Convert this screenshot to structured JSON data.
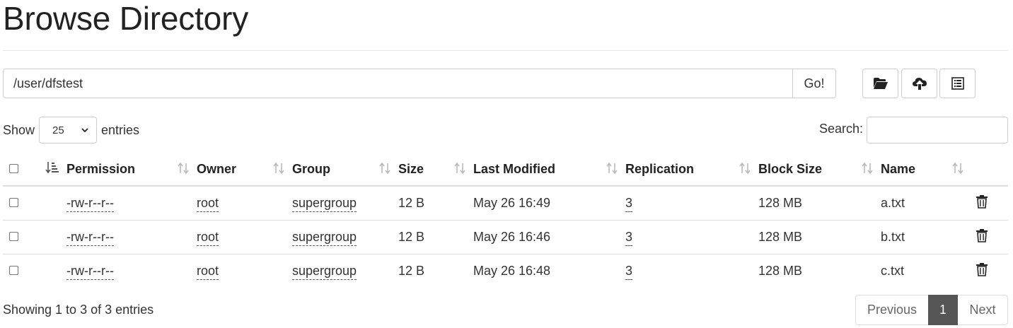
{
  "header": {
    "title": "Browse Directory"
  },
  "path_bar": {
    "value": "/user/dfstest",
    "go_label": "Go!"
  },
  "toolbar": {
    "buttons": [
      {
        "icon": "folder-open-icon"
      },
      {
        "icon": "cloud-upload-icon"
      },
      {
        "icon": "list-icon"
      }
    ]
  },
  "length_control": {
    "show_label": "Show",
    "selected": "25",
    "entries_label": "entries"
  },
  "search": {
    "label": "Search:",
    "value": ""
  },
  "table": {
    "columns": [
      "Permission",
      "Owner",
      "Group",
      "Size",
      "Last Modified",
      "Replication",
      "Block Size",
      "Name"
    ],
    "rows": [
      {
        "permission": "-rw-r--r--",
        "owner": "root",
        "group": "supergroup",
        "size": "12 B",
        "modified": "May 26 16:49",
        "replication": "3",
        "block_size": "128 MB",
        "name": "a.txt"
      },
      {
        "permission": "-rw-r--r--",
        "owner": "root",
        "group": "supergroup",
        "size": "12 B",
        "modified": "May 26 16:46",
        "replication": "3",
        "block_size": "128 MB",
        "name": "b.txt"
      },
      {
        "permission": "-rw-r--r--",
        "owner": "root",
        "group": "supergroup",
        "size": "12 B",
        "modified": "May 26 16:48",
        "replication": "3",
        "block_size": "128 MB",
        "name": "c.txt"
      }
    ]
  },
  "footer": {
    "info": "Showing 1 to 3 of 3 entries"
  },
  "pagination": {
    "previous": "Previous",
    "current": "1",
    "next": "Next"
  }
}
